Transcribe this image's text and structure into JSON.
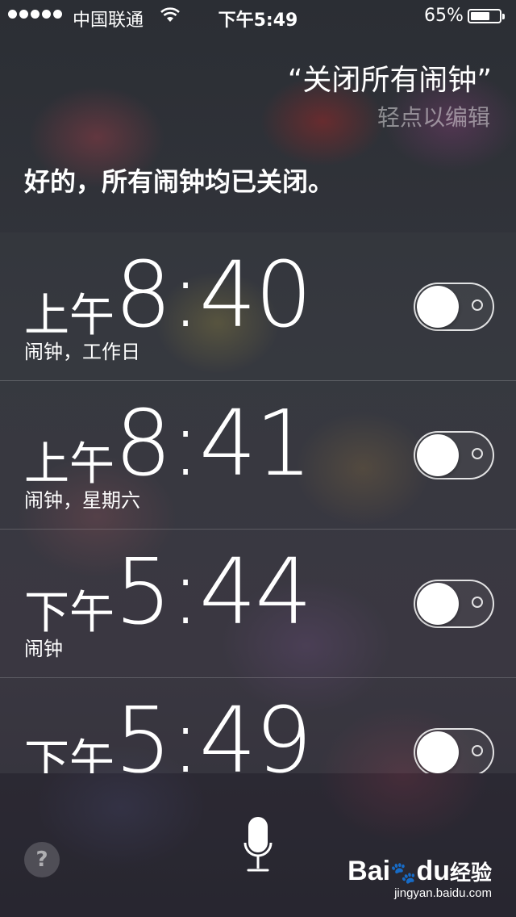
{
  "status_bar": {
    "carrier": "中国联通",
    "time": "下午5:49",
    "battery_percent": "65%",
    "battery_level": 0.65,
    "signal_dots": 5
  },
  "siri": {
    "query": "“关闭所有闹钟”",
    "edit_hint": "轻点以编辑",
    "response": "好的，所有闹钟均已关闭。"
  },
  "alarms": [
    {
      "period": "上午",
      "time": "8:40",
      "label": "闹钟，工作日",
      "enabled": false
    },
    {
      "period": "上午",
      "time": "8:41",
      "label": "闹钟，星期六",
      "enabled": false
    },
    {
      "period": "下午",
      "time": "5:44",
      "label": "闹钟",
      "enabled": false
    },
    {
      "period": "下午",
      "time": "5:49",
      "label": "",
      "enabled": false
    }
  ],
  "bottom": {
    "help_glyph": "?",
    "mic_icon": "microphone-icon"
  },
  "watermark": {
    "logo": "Bai",
    "logo_tail": "du",
    "logo_cn": "经验",
    "url": "jingyan.baidu.com"
  }
}
